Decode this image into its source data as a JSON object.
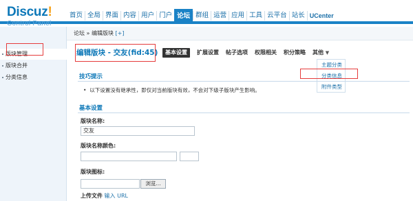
{
  "logo": {
    "main": "Discuz",
    "bang": "!",
    "sub": "Control Panel"
  },
  "topnav": [
    "首页",
    "全局",
    "界面",
    "内容",
    "用户",
    "门户",
    "论坛",
    "群组",
    "运营",
    "应用",
    "工具",
    "云平台",
    "站长",
    "UCenter"
  ],
  "topnav_active": "论坛",
  "sidebar": [
    "版块管理",
    "版块合并",
    "分类信息"
  ],
  "breadcrumb": {
    "path": "论坛 » 编辑版块",
    "plus": "[+]"
  },
  "page_title": "编辑版块 - 交友(fid:45)",
  "tabs": [
    "基本设置",
    "扩展设置",
    "帖子选项",
    "权限相关",
    "积分策略",
    "其他"
  ],
  "dropdown": [
    "主题分类",
    "分类信息",
    "附件类型"
  ],
  "tips": {
    "title": "技巧提示",
    "text": "以下设置没有继承性，即仅对当前版块有效，不会对下级子版块产生影响。"
  },
  "basic": {
    "title": "基本设置",
    "name_label": "版块名称:",
    "name_value": "交友",
    "color_label": "版块名称颜色:",
    "icon_label": "版块图标:",
    "browse": "浏览...",
    "upload_label": "上传文件",
    "upload_alt": "输入 URL"
  },
  "colors": {
    "accent": "#1a82c6",
    "highlight": "#e53b3b",
    "sidebar_bg": "#eef4fa"
  }
}
